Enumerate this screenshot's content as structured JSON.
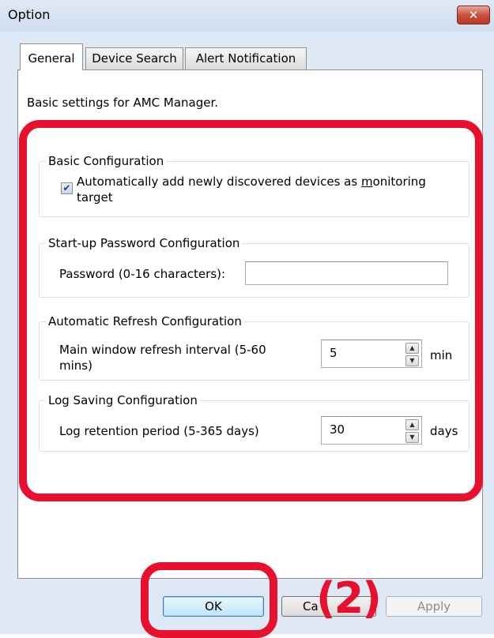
{
  "window": {
    "title": "Option",
    "close_icon": "close-icon"
  },
  "tabs": [
    {
      "label": "General",
      "active": true
    },
    {
      "label": "Device Search",
      "active": false
    },
    {
      "label": "Alert Notification",
      "active": false
    }
  ],
  "general": {
    "subtitle": "Basic settings for AMC Manager.",
    "basic": {
      "legend": "Basic Configuration",
      "checkbox_label_pre": "Automatically add newly discovered devices as ",
      "checkbox_label_mnemonic": "m",
      "checkbox_label_post": "onitoring target",
      "checked": true
    },
    "startup": {
      "legend": "Start-up Password Configuration",
      "password_label": "Password (0-16 characters):",
      "password_value": ""
    },
    "refresh": {
      "legend": "Automatic Refresh Configuration",
      "interval_label": "Main window refresh interval (5-60 mins)",
      "interval_value": "5",
      "unit": "min"
    },
    "log": {
      "legend": "Log Saving Configuration",
      "retention_label": "Log retention period (5-365 days)",
      "retention_value": "30",
      "unit": "days"
    }
  },
  "buttons": {
    "ok": "OK",
    "cancel": "Ca",
    "apply": "Apply"
  },
  "annotation": {
    "label": "(2)",
    "color": "#e8112d"
  }
}
